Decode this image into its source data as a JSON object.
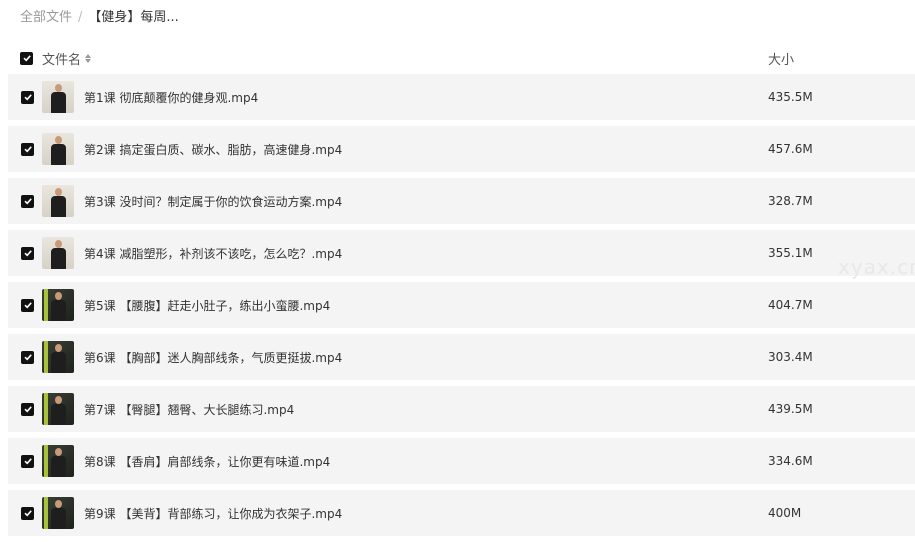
{
  "breadcrumb": {
    "root": "全部文件",
    "separator": "/",
    "current": "【健身】每周..."
  },
  "header": {
    "name_label": "文件名",
    "size_label": "大小"
  },
  "files": [
    {
      "name": "第1课 彻底颠覆你的健身观.mp4",
      "size": "435.5M",
      "thumb": "light"
    },
    {
      "name": "第2课 搞定蛋白质、碳水、脂肪，高速健身.mp4",
      "size": "457.6M",
      "thumb": "light"
    },
    {
      "name": "第3课 没时间？制定属于你的饮食运动方案.mp4",
      "size": "328.7M",
      "thumb": "light"
    },
    {
      "name": "第4课 减脂塑形，补剂该不该吃，怎么吃？.mp4",
      "size": "355.1M",
      "thumb": "light"
    },
    {
      "name": "第5课 【腰腹】赶走小肚子，练出小蛮腰.mp4",
      "size": "404.7M",
      "thumb": "gym"
    },
    {
      "name": "第6课 【胸部】迷人胸部线条，气质更挺拔.mp4",
      "size": "303.4M",
      "thumb": "gym"
    },
    {
      "name": "第7课 【臀腿】翘臀、大长腿练习.mp4",
      "size": "439.5M",
      "thumb": "gym"
    },
    {
      "name": "第8课 【香肩】肩部线条，让你更有味道.mp4",
      "size": "334.6M",
      "thumb": "gym"
    },
    {
      "name": "第9课 【美背】背部练习，让你成为衣架子.mp4",
      "size": "400M",
      "thumb": "gym"
    }
  ],
  "watermark": "xyax.cn",
  "colors": {
    "row_bg": "#f4f4f4",
    "checkbox": "#111111",
    "accent_gym": "#a9c23a"
  }
}
